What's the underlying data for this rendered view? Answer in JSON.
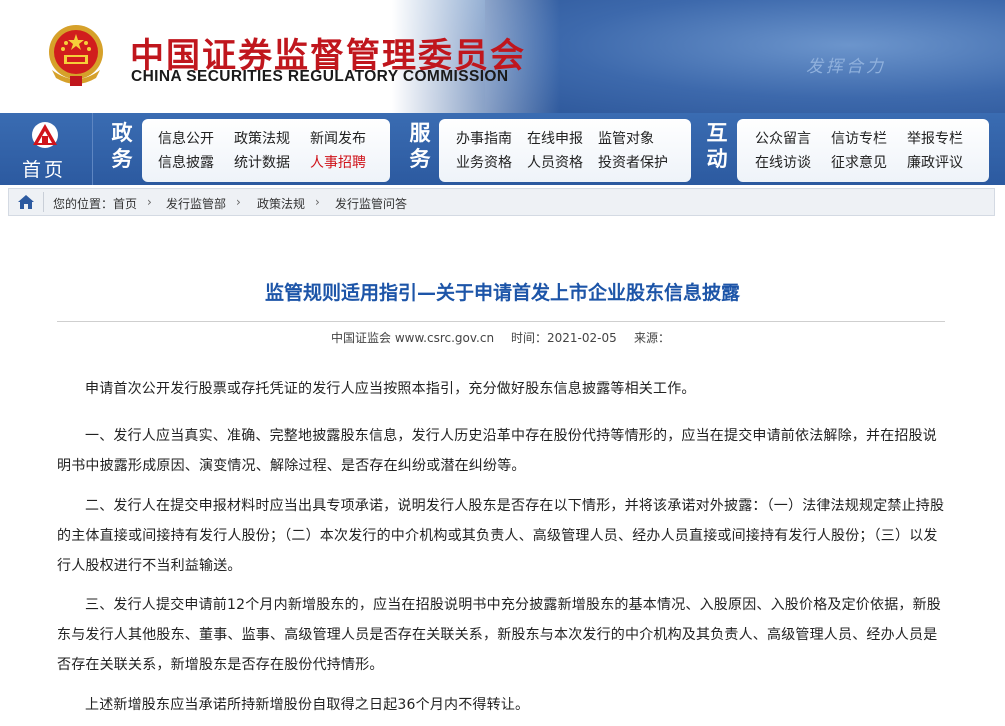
{
  "header": {
    "title_cn": "中国证券监督管理委员会",
    "title_en": "CHINA SECURITIES REGULATORY COMMISSION",
    "slogan": "发挥合力",
    "emblem_icon": "national-emblem-icon"
  },
  "nav": {
    "home_label": "首页",
    "groups": [
      {
        "title": "政务",
        "links": [
          "信息公开",
          "政策法规",
          "新闻发布",
          "信息披露",
          "统计数据",
          "人事招聘"
        ]
      },
      {
        "title": "服务",
        "links": [
          "办事指南",
          "在线申报",
          "监管对象",
          "业务资格",
          "人员资格",
          "投资者保护"
        ]
      },
      {
        "title": "互动",
        "links": [
          "公众留言",
          "信访专栏",
          "举报专栏",
          "在线访谈",
          "征求意见",
          "廉政评议"
        ]
      }
    ],
    "highlight_color": "#d0141b"
  },
  "breadcrumb": {
    "prefix": "您的位置：",
    "items": [
      "首页",
      "发行监管部",
      "政策法规",
      "发行监管问答"
    ]
  },
  "article": {
    "title": "监管规则适用指引—关于申请首发上市企业股东信息披露",
    "source": "中国证监会 www.csrc.gov.cn",
    "time": "时间：2021-02-05",
    "origin": "来源：",
    "paragraphs": [
      "申请首次公开发行股票或存托凭证的发行人应当按照本指引，充分做好股东信息披露等相关工作。",
      "一、发行人应当真实、准确、完整地披露股东信息，发行人历史沿革中存在股份代持等情形的，应当在提交申请前依法解除，并在招股说明书中披露形成原因、演变情况、解除过程、是否存在纠纷或潜在纠纷等。",
      "二、发行人在提交申报材料时应当出具专项承诺，说明发行人股东是否存在以下情形，并将该承诺对外披露：（一）法律法规规定禁止持股的主体直接或间接持有发行人股份；（二）本次发行的中介机构或其负责人、高级管理人员、经办人员直接或间接持有发行人股份；（三）以发行人股权进行不当利益输送。",
      "三、发行人提交申请前12个月内新增股东的，应当在招股说明书中充分披露新增股东的基本情况、入股原因、入股价格及定价依据，新股东与发行人其他股东、董事、监事、高级管理人员是否存在关联关系，新股东与本次发行的中介机构及其负责人、高级管理人员、经办人员是否存在关联关系，新增股东是否存在股份代持情形。",
      "上述新增股东应当承诺所持新增股份自取得之日起36个月内不得转让。"
    ]
  }
}
